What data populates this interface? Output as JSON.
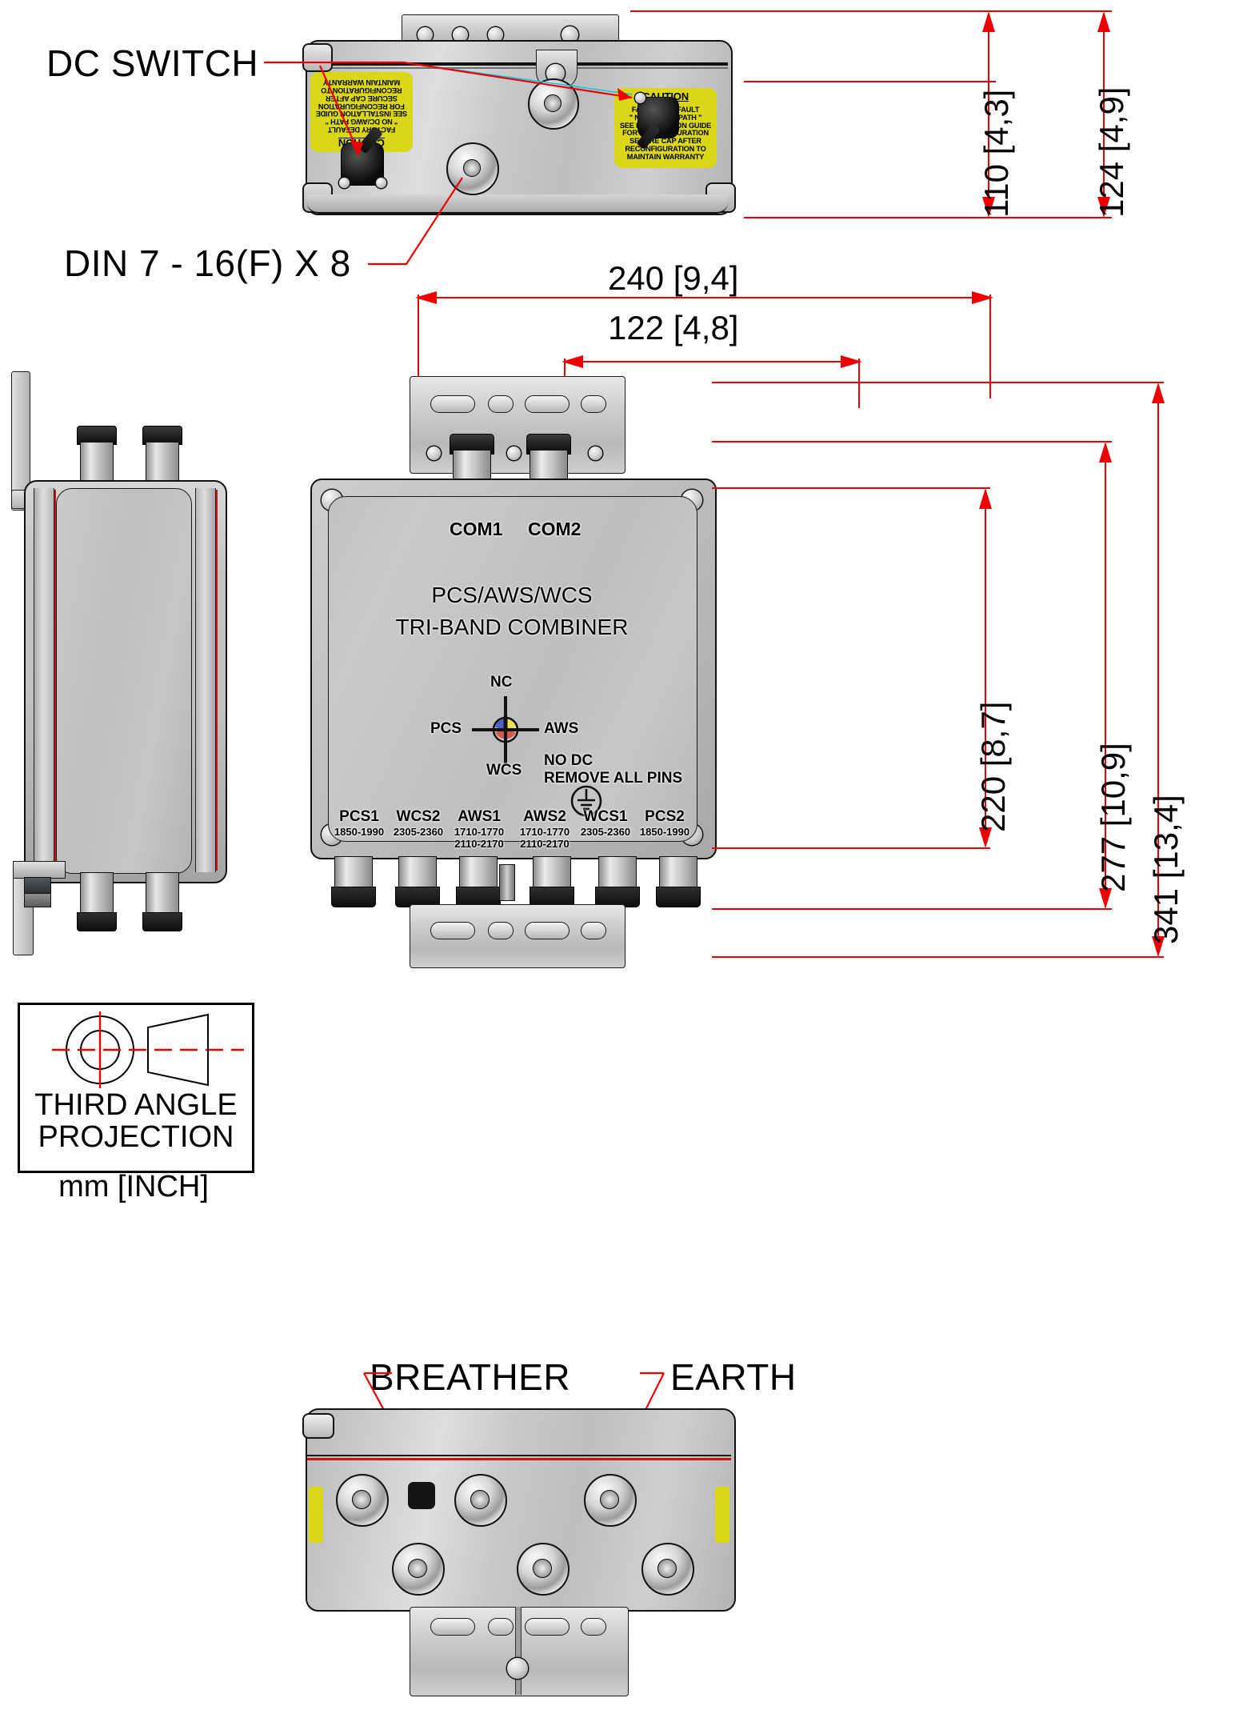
{
  "drawing": {
    "units_note": "mm [INCH]",
    "projection_title_line1": "THIRD ANGLE",
    "projection_title_line2": "PROJECTION"
  },
  "callouts": {
    "dc_switch": "DC SWITCH",
    "din_connector": "DIN 7 - 16(F) X 8",
    "breather": "BREATHER",
    "earth": "EARTH"
  },
  "dimensions": {
    "top_height_inner": "110 [4,3]",
    "top_height_outer": "124 [4,9]",
    "front_width_outer": "240 [9,4]",
    "front_width_inner": "122 [4,8]",
    "front_height_body": "220 [8,7]",
    "front_height_mid": "277 [10,9]",
    "front_height_total": "341 [13,4]"
  },
  "caution_label": {
    "title": "CAUTION",
    "lines": [
      "FACTORY DEFAULT",
      "\" NO DC/AWG PATH \"",
      "SEE INSTALLATION GUIDE",
      "FOR RECONFIGURATION",
      "SECURE CAP AFTER",
      "RECONFIGURATION TO",
      "MAINTAIN WARRANTY"
    ]
  },
  "front_panel": {
    "com_labels": [
      "COM1",
      "COM2"
    ],
    "product_line1": "PCS/AWS/WCS",
    "product_line2": "TRI-BAND COMBINER",
    "rotary_switch": {
      "north": "NC",
      "west": "PCS",
      "east": "AWS",
      "south": "WCS",
      "note_line1": "NO DC",
      "note_line2": "REMOVE ALL PINS",
      "colors": {
        "blue": "#4a63c8",
        "yellow": "#f0df55",
        "red": "#cf5a4d"
      }
    },
    "ports": [
      {
        "name": "PCS1",
        "freq1": "1850-1990",
        "freq2": ""
      },
      {
        "name": "WCS2",
        "freq1": "2305-2360",
        "freq2": ""
      },
      {
        "name": "AWS1",
        "freq1": "1710-1770",
        "freq2": "2110-2170"
      },
      {
        "name": "AWS2",
        "freq1": "1710-1770",
        "freq2": "2110-2170"
      },
      {
        "name": "WCS1",
        "freq1": "2305-2360",
        "freq2": ""
      },
      {
        "name": "PCS2",
        "freq1": "1850-1990",
        "freq2": ""
      }
    ],
    "earth_symbol_name": "protective-earth-icon"
  },
  "colors": {
    "dimension_red": "#ef0000",
    "leader_cyan": "#00c8e0",
    "label_yellow": "#d9d717",
    "body_gray": "#c2c4c6"
  }
}
